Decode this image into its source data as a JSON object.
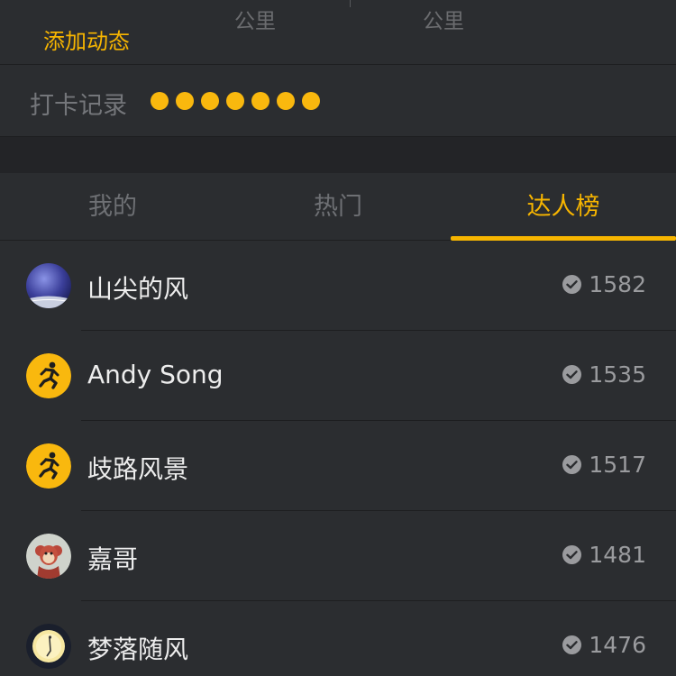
{
  "stats": {
    "add_label": "添加动态",
    "unit_left": "公里",
    "unit_right": "公里"
  },
  "checkin": {
    "label": "打卡记录",
    "count": 7,
    "dot_color": "#f9b80e"
  },
  "tabs": [
    {
      "label": "我的",
      "active": false
    },
    {
      "label": "热门",
      "active": false
    },
    {
      "label": "达人榜",
      "active": true
    }
  ],
  "accent_color": "#f7b500",
  "leaderboard": [
    {
      "name": "山尖的风",
      "score": "1582",
      "avatar": "night-sky-avatar"
    },
    {
      "name": "Andy Song",
      "score": "1535",
      "avatar": "runner-icon"
    },
    {
      "name": "歧路风景",
      "score": "1517",
      "avatar": "runner-icon"
    },
    {
      "name": "嘉哥",
      "score": "1481",
      "avatar": "monkey-avatar"
    },
    {
      "name": "梦落随风",
      "score": "1476",
      "avatar": "moon-avatar"
    }
  ]
}
